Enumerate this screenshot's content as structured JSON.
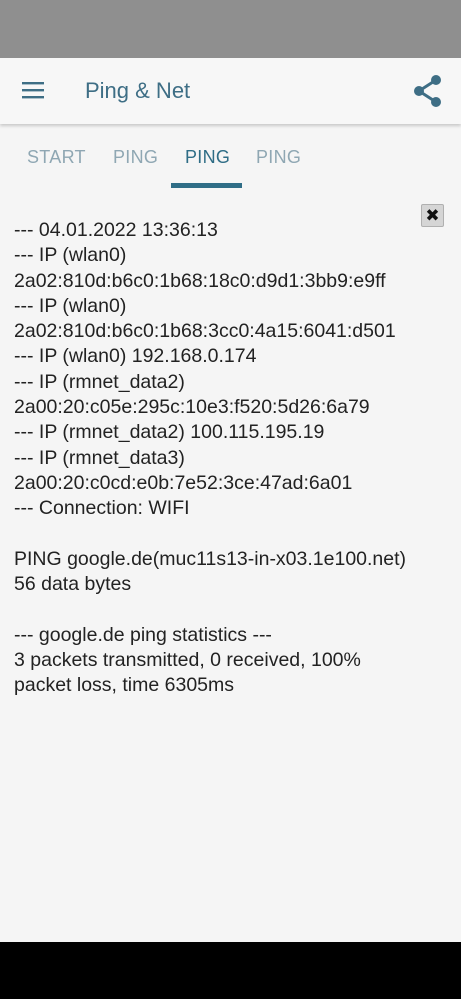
{
  "app": {
    "title": "Ping & Net",
    "accent_color": "#3e6e85",
    "menu_icon": "hamburger-menu-icon",
    "share_icon": "share-icon"
  },
  "tabs": [
    {
      "label": "START",
      "active": false
    },
    {
      "label": "PING",
      "active": false
    },
    {
      "label": "PING",
      "active": true
    },
    {
      "label": "PING",
      "active": false
    }
  ],
  "close_button": {
    "label": "✖",
    "icon": "close-icon"
  },
  "output": {
    "lines": [
      "--- 04.01.2022 13:36:13",
      "--- IP (wlan0)",
      "2a02:810d:b6c0:1b68:18c0:d9d1:3bb9:e9ff",
      "--- IP (wlan0)",
      "2a02:810d:b6c0:1b68:3cc0:4a15:6041:d501",
      "--- IP (wlan0) 192.168.0.174",
      "--- IP (rmnet_data2)",
      "2a00:20:c05e:295c:10e3:f520:5d26:6a79",
      "--- IP (rmnet_data2) 100.115.195.19",
      "--- IP (rmnet_data3)",
      "2a00:20:c0cd:e0b:7e52:3ce:47ad:6a01",
      "--- Connection: WIFI",
      "",
      "PING google.de(muc11s13-in-x03.1e100.net)",
      "56 data bytes",
      "",
      "--- google.de ping statistics ---",
      "3 packets transmitted, 0 received, 100%",
      "packet loss, time 6305ms"
    ]
  }
}
